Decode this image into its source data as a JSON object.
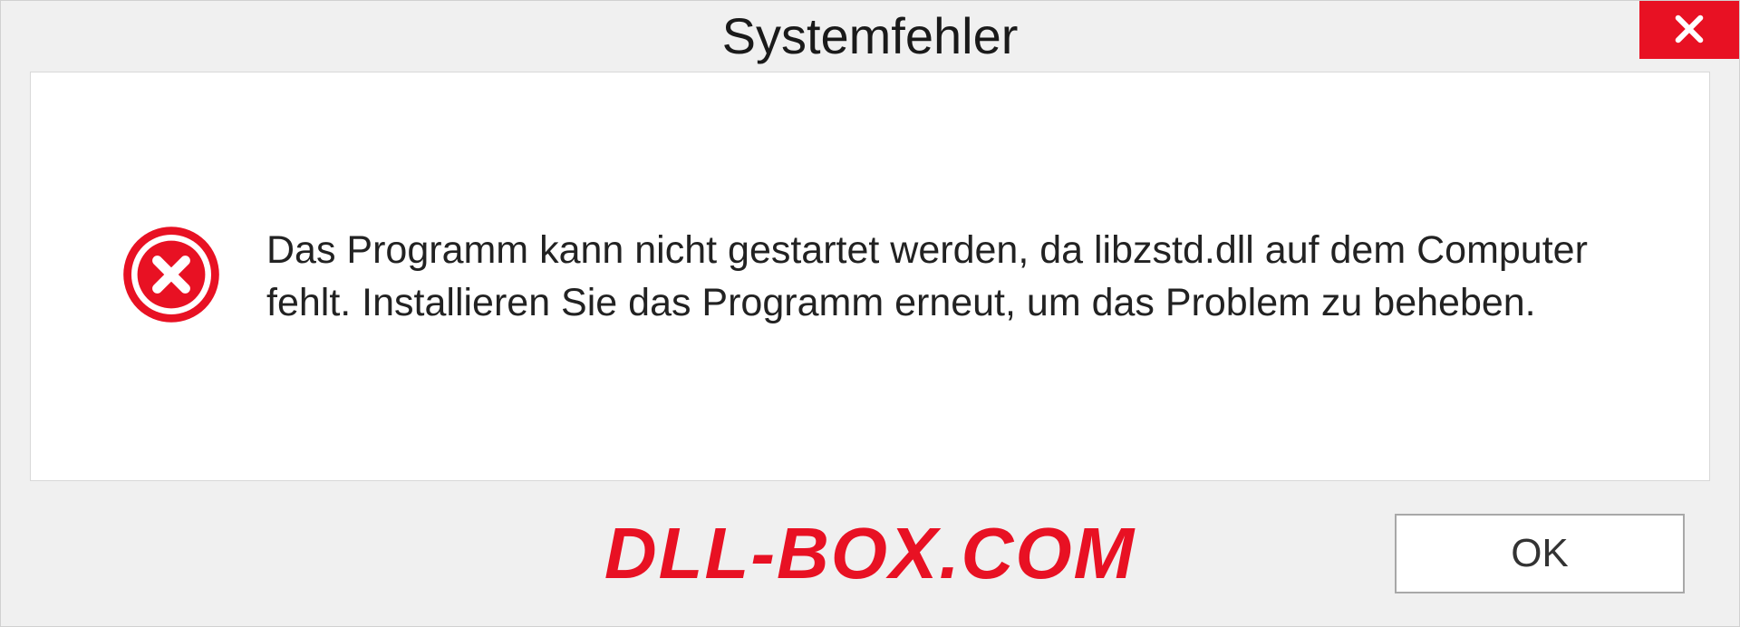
{
  "dialog": {
    "title": "Systemfehler",
    "message": "Das Programm kann nicht gestartet werden, da libzstd.dll auf dem Computer fehlt. Installieren Sie das Programm erneut, um das Problem zu beheben.",
    "ok_label": "OK"
  },
  "watermark": "DLL-BOX.COM"
}
